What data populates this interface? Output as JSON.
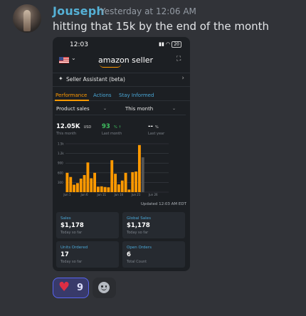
{
  "message": {
    "username": "Jouseph",
    "timestamp": "Yesterday at 12:06 AM",
    "text": "hitting that 15k by the end of the month"
  },
  "phone": {
    "status_time": "12:03",
    "battery": "20",
    "brand": "amazon seller",
    "assistant_label": "Seller Assistant (beta)",
    "tabs": [
      "Performance",
      "Actions",
      "Stay Informed"
    ],
    "metric_select": "Product sales",
    "period_select": "This month",
    "metrics": [
      {
        "value": "12.05K",
        "unit": "USD",
        "sub": "This month"
      },
      {
        "value": "93",
        "unit": "% ↑",
        "sub": "Last month"
      },
      {
        "value": "-- ",
        "unit": "%",
        "sub": "Last year"
      }
    ],
    "updated": "Updated 12:03 AM EDT",
    "cards": [
      {
        "title": "Sales",
        "value": "$1,178",
        "sub": "Today so far"
      },
      {
        "title": "Global Sales",
        "value": "$1,178",
        "sub": "Today so far"
      },
      {
        "title": "Units Ordered",
        "value": "17",
        "sub": "Today so far"
      },
      {
        "title": "Open Orders",
        "value": "6",
        "sub": "Total Count"
      }
    ]
  },
  "chart_data": {
    "type": "bar",
    "y_ticks": [
      "1.5k",
      "1.2k",
      "900",
      "600",
      "300"
    ],
    "ylim": [
      0,
      1500
    ],
    "x_ticks": [
      "Jun 1",
      "Jun 6",
      "Jun 11",
      "Jun 16",
      "Jun 21",
      "Jun 26"
    ],
    "values": [
      600,
      470,
      230,
      280,
      420,
      530,
      920,
      430,
      600,
      170,
      180,
      160,
      150,
      990,
      570,
      240,
      360,
      600,
      80,
      620,
      640,
      1460,
      1080
    ],
    "bar_colors": {
      "past": "#ff9900",
      "today": "#555555"
    },
    "colors": {
      "accent": "#ff9900",
      "link": "#4aa8d8",
      "grid": "#3a3f46"
    }
  },
  "reactions": {
    "heart_count": "9"
  }
}
